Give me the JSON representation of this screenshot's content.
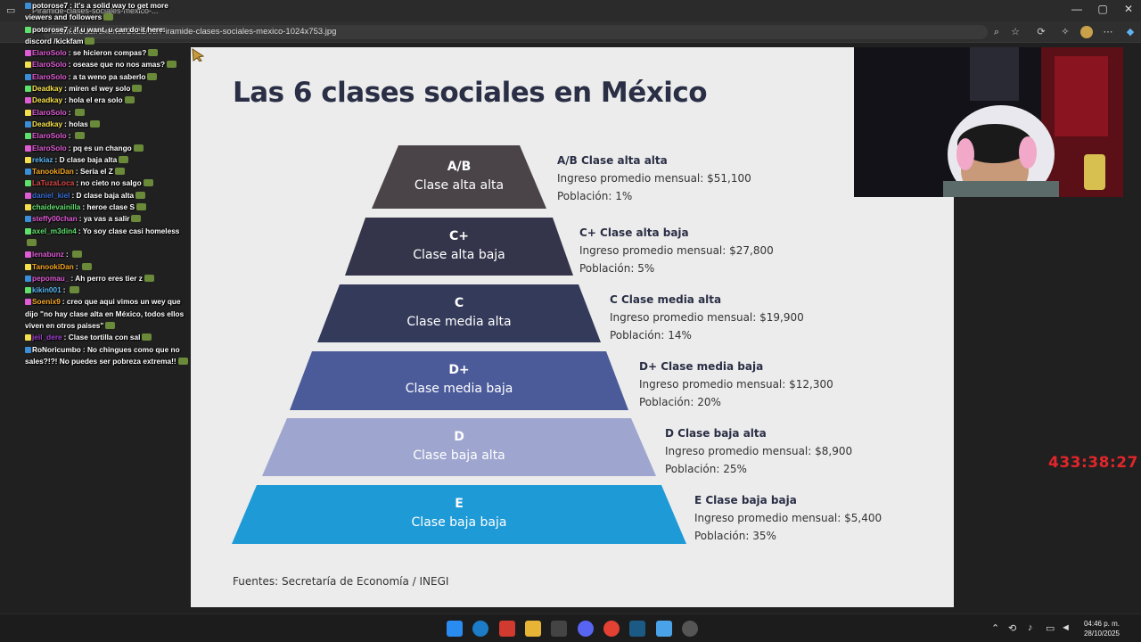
{
  "browser": {
    "tab_title": "Piramide-clases-sociales-mexico-...",
    "url": "m5m.cloudfront.net/2021/09/Piramide-clases-sociales-mexico-1024x753.jpg",
    "window_controls": {
      "minimize": "—",
      "maximize": "▢",
      "close": "✕"
    }
  },
  "chat": [
    {
      "user": "potorose7",
      "user_color": "#ffffff",
      "text": "it's a solid way to get more viewers and followers"
    },
    {
      "user": "potorose7",
      "user_color": "#ffffff",
      "text": "if u want, u can do it here: discord /kickfam"
    },
    {
      "user": "ElaroSolo",
      "user_color": "#e05bd6",
      "text": "se hicieron compas?"
    },
    {
      "user": "ElaroSolo",
      "user_color": "#e05bd6",
      "text": "osease que no nos amas?"
    },
    {
      "user": "ElaroSolo",
      "user_color": "#e05bd6",
      "text": "a ta weno pa saberlo"
    },
    {
      "user": "Deadkay",
      "user_color": "#f4e04d",
      "text": "miren el wey solo"
    },
    {
      "user": "Deadkay",
      "user_color": "#f4e04d",
      "text": "hola el era solo"
    },
    {
      "user": "ElaroSolo",
      "user_color": "#e05bd6",
      "text": ""
    },
    {
      "user": "Deadkay",
      "user_color": "#f4e04d",
      "text": "holas"
    },
    {
      "user": "ElaroSolo",
      "user_color": "#e05bd6",
      "text": ""
    },
    {
      "user": "ElaroSolo",
      "user_color": "#e05bd6",
      "text": "pq es un chango"
    },
    {
      "user": "rekiaz",
      "user_color": "#5bb8f5",
      "text": "D clase baja alta"
    },
    {
      "user": "TanookiDan",
      "user_color": "#f5a623",
      "text": "Sería el Z"
    },
    {
      "user": "LaTuzaLoca",
      "user_color": "#e04848",
      "text": "no cieto no salgo"
    },
    {
      "user": "daniel_kiel",
      "user_color": "#3a6fd8",
      "text": "D clase baja alta"
    },
    {
      "user": "chaidevainilla",
      "user_color": "#5ee06b",
      "text": "heroe clase S"
    },
    {
      "user": "steffy00chan",
      "user_color": "#e05bd6",
      "text": "ya vas a salir"
    },
    {
      "user": "axel_m3din4",
      "user_color": "#5ee06b",
      "text": "Yo soy clase casi homeless"
    },
    {
      "user": "lenabunz",
      "user_color": "#e05bd6",
      "text": ""
    },
    {
      "user": "TanookiDan",
      "user_color": "#f5a623",
      "text": ""
    },
    {
      "user": "pepomau_",
      "user_color": "#e05bd6",
      "text": "Ah perro eres tier z"
    },
    {
      "user": "kikin001",
      "user_color": "#5bb8f5",
      "text": ""
    },
    {
      "user": "Soenix9",
      "user_color": "#f5a623",
      "text": "creo que aqui vimos un wey que dijo \"no hay clase alta en México, todos ellos viven en otros paises\""
    },
    {
      "user": "jeil_dere",
      "user_color": "#a040d0",
      "text": "Clase tortilla con sal"
    },
    {
      "user": "RoNoricumbo",
      "user_color": "#ffffff",
      "text": "No chingues como que no sales?!?! No puedes ser pobreza extrema!!"
    }
  ],
  "slide": {
    "title": "Las 6 clases sociales en México",
    "tiers": [
      {
        "code": "A/B",
        "name": "Clase alta alta",
        "color": "#4a4448",
        "heading": "A/B Clase alta alta",
        "income": "Ingreso promedio mensual: $51,100",
        "population": "Población: 1%"
      },
      {
        "code": "C+",
        "name": "Clase alta baja",
        "color": "#34354a",
        "heading": "C+ Clase alta baja",
        "income": "Ingreso promedio mensual: $27,800",
        "population": "Población: 5%"
      },
      {
        "code": "C",
        "name": "Clase media alta",
        "color": "#343a5a",
        "heading": "C Clase media alta",
        "income": "Ingreso promedio mensual: $19,900",
        "population": "Población: 14%"
      },
      {
        "code": "D+",
        "name": "Clase media baja",
        "color": "#4b5b9a",
        "heading": "D+ Clase media baja",
        "income": "Ingreso promedio mensual: $12,300",
        "population": "Población: 20%"
      },
      {
        "code": "D",
        "name": "Clase baja alta",
        "color": "#9ea6cf",
        "heading": "D Clase baja alta",
        "income": "Ingreso promedio mensual: $8,900",
        "population": "Población: 25%"
      },
      {
        "code": "E",
        "name": "Clase baja baja",
        "color": "#1e9ad6",
        "heading": "E Clase baja baja",
        "income": "Ingreso promedio mensual: $5,400",
        "population": "Población: 35%"
      }
    ],
    "source": "Fuentes: Secretaría de Economía / INEGI"
  },
  "timer": "433:38:27",
  "taskbar": {
    "clock_time": "04:46 p. m.",
    "clock_date": "28/10/2025"
  }
}
